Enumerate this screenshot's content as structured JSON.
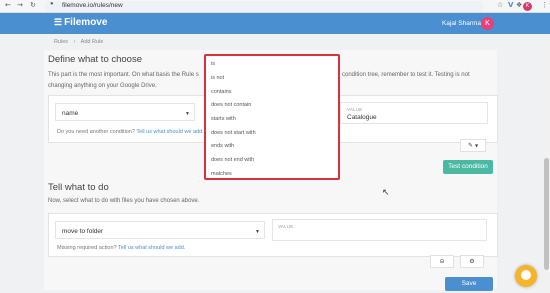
{
  "browser": {
    "back_icon": "arrow-left-icon",
    "forward_icon": "arrow-right-icon",
    "reload_icon": "reload-icon",
    "url": "filemove.io/rules/new",
    "profile_initial": "K"
  },
  "app": {
    "logo": "Filemove",
    "user_name": "Kajal Sharma",
    "user_initial": "K"
  },
  "breadcrumb": [
    "Rules",
    "Add Rule"
  ],
  "section1": {
    "title": "Define what to choose",
    "description_line1": "This part is the most important. On what basis the Rule s",
    "description_line1_tail": "condition tree, remember to test it. Testing is not",
    "description_line2": "changing anything on your Google Drive.",
    "condition_field": "name",
    "value_label": "VALUE",
    "value": "Catalogue",
    "help_text": "Do you need another condition? ",
    "help_link": "Tell us what should we add.",
    "test_button": "Test condition"
  },
  "operator_dropdown": {
    "options": [
      "is",
      "is not",
      "contains",
      "does not contain",
      "starts with",
      "does not start with",
      "ends with",
      "does not end with",
      "matches"
    ]
  },
  "section2": {
    "title": "Tell what to do",
    "description": "Now, select what to do with files you have chosen above.",
    "action": "move to folder",
    "value_label": "VALUE",
    "help_text": "Missing required action? ",
    "help_link": "Tell us what should we add.",
    "save_button": "Save"
  },
  "colors": {
    "header": "#4a8fd0",
    "accent_teal": "#4bb8a3",
    "dropdown_border": "#d9323a",
    "avatar": "#e6417a"
  }
}
